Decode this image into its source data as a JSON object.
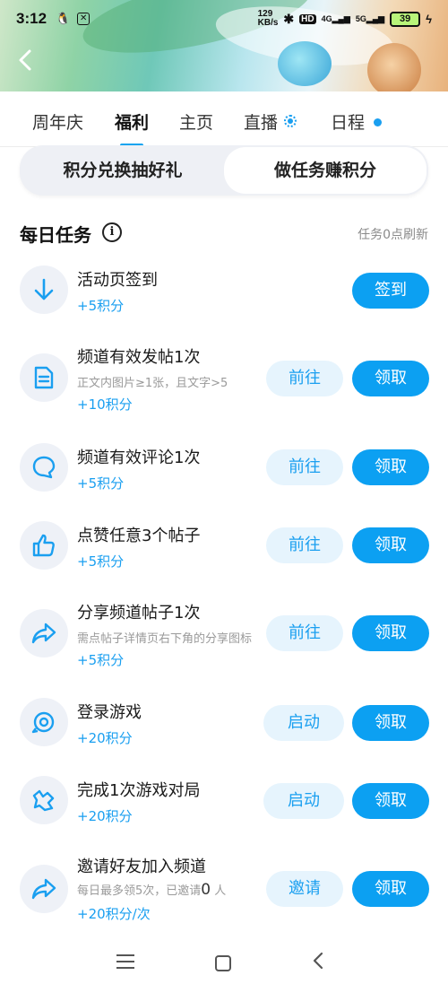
{
  "status": {
    "time": "3:12",
    "net_speed_value": "129",
    "net_speed_unit": "KB/s",
    "hd": "HD",
    "net_4g": "4G",
    "net_5g": "5G",
    "battery": "39"
  },
  "tabs": [
    {
      "label": "周年庆",
      "active": false
    },
    {
      "label": "福利",
      "active": true
    },
    {
      "label": "主页",
      "active": false
    },
    {
      "label": "直播",
      "active": false
    },
    {
      "label": "日程",
      "active": false
    }
  ],
  "segment": {
    "left_label": "积分兑换抽好礼",
    "right_label": "做任务赚积分"
  },
  "daily": {
    "title": "每日任务",
    "refresh_note": "任务0点刷新"
  },
  "tasks": [
    {
      "title": "活动页签到",
      "desc": "",
      "reward": "+5积分",
      "go": "",
      "action": "签到",
      "icon": "download-arrow-icon"
    },
    {
      "title": "频道有效发帖1次",
      "desc": "正文内图片≥1张，且文字>5",
      "reward": "+10积分",
      "go": "前往",
      "action": "领取",
      "icon": "document-icon"
    },
    {
      "title": "频道有效评论1次",
      "desc": "",
      "reward": "+5积分",
      "go": "前往",
      "action": "领取",
      "icon": "comment-bubble-icon"
    },
    {
      "title": "点赞任意3个帖子",
      "desc": "",
      "reward": "+5积分",
      "go": "前往",
      "action": "领取",
      "icon": "thumbs-up-icon"
    },
    {
      "title": "分享频道帖子1次",
      "desc": "需点帖子详情页右下角的分享图标",
      "reward": "+5积分",
      "go": "前往",
      "action": "领取",
      "icon": "share-arrow-icon"
    },
    {
      "title": "登录游戏",
      "desc": "",
      "reward": "+20积分",
      "go": "启动",
      "action": "领取",
      "icon": "game-login-icon"
    },
    {
      "title": "完成1次游戏对局",
      "desc": "",
      "reward": "+20积分",
      "go": "启动",
      "action": "领取",
      "icon": "game-match-icon"
    },
    {
      "title": "邀请好友加入频道",
      "desc_prefix": "每日最多领5次，已邀请",
      "desc_count": "0",
      "desc_suffix": "人",
      "reward": "+20积分/次",
      "go": "邀请",
      "action": "领取",
      "icon": "invite-share-icon"
    }
  ],
  "colors": {
    "accent": "#0ca0f2",
    "accent_light": "#e6f4fd",
    "reward_text": "#1a9ff0"
  }
}
